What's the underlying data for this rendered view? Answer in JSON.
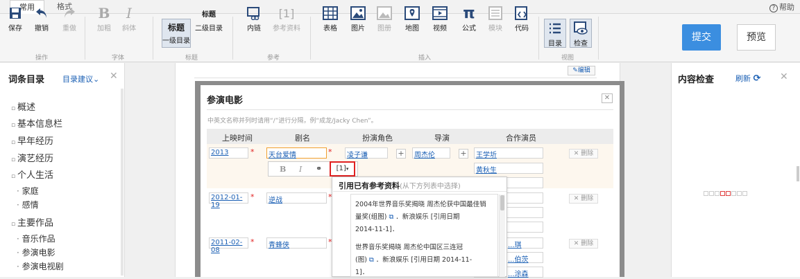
{
  "tabs": [
    {
      "label": "常用"
    },
    {
      "label": "格式"
    }
  ],
  "help": "帮助",
  "toolbar": {
    "save": "保存",
    "undo": "撤销",
    "redo": "重做",
    "bold": "加粗",
    "italic": "斜体",
    "h1": "一级目录",
    "h2": "二级目录",
    "h_big": "标题",
    "h_small": "标题",
    "link": "内链",
    "ref": "参考资料",
    "ref_glyph": "[1]",
    "table": "表格",
    "image": "图片",
    "album": "图册",
    "map": "地图",
    "video": "视频",
    "formula": "公式",
    "module": "模块",
    "code": "代码",
    "toc": "目录",
    "check": "检查",
    "groups": {
      "op": "操作",
      "font": "字体",
      "title": "标题",
      "ref": "参考",
      "insert": "插入",
      "view": "视图"
    }
  },
  "submit": "提交",
  "preview": "预览",
  "sidebar": {
    "title": "词条目录",
    "suggest": "目录建议",
    "items": [
      "概述",
      "基本信息栏",
      "早年经历",
      "演艺经历",
      "个人生活"
    ],
    "sub1": [
      "家庭",
      "感情"
    ],
    "item_works": "主要作品",
    "sub2": [
      "音乐作品",
      "参演电影",
      "参演电视剧"
    ]
  },
  "doc": {
    "edit": "编辑"
  },
  "modal": {
    "title": "参演电影",
    "hint": "中英文名称并列时请用“/”进行分隔，例“成龙/Jacky Chen”。",
    "headers": [
      "上映时间",
      "剧名",
      "扮演角色",
      "导演",
      "合作演员"
    ],
    "rows": [
      {
        "date": "2013",
        "title": "天台爱情",
        "role": "凌子谦",
        "director": "周杰伦",
        "actors": [
          "王学圻",
          "黄秋生"
        ]
      },
      {
        "date": "2012-01-19",
        "title": "逆战",
        "role": "",
        "director": "",
        "actors": []
      },
      {
        "date": "2011-02-08",
        "title": "青蜂侠",
        "role": "",
        "director": "",
        "actors": [
          "...琪",
          "...伯茨",
          "...涂森"
        ]
      }
    ],
    "delete": "删除"
  },
  "rte": {
    "bold": "B",
    "italic": "I",
    "ref": "[1]"
  },
  "popup": {
    "title": "引用已有参考资料",
    "title_sub": "(从下方列表中选择)",
    "refs": [
      {
        "line1": "2004年世界音乐奖揭晓 周杰伦获中国最佳销",
        "line2": "量奖(组图)",
        "line2b": "．新浪娱乐 [引用日期",
        "line3": "2014-11-1]．"
      },
      {
        "line1": "世界音乐奖揭晓 周杰伦中国区三连冠",
        "line2": "(图)",
        "line2b": "．新浪娱乐 [引用日期 2014-11-",
        "line3": "1]．"
      }
    ]
  },
  "right": {
    "title": "内容检查",
    "refresh": "刷新"
  }
}
